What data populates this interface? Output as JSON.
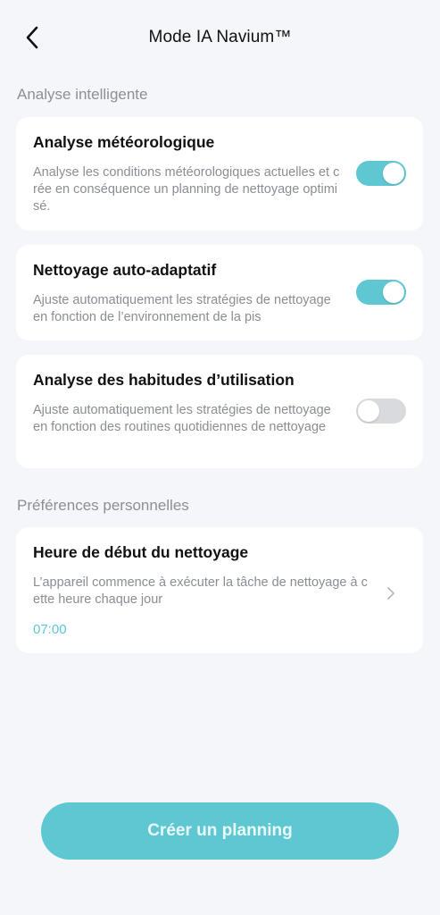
{
  "header": {
    "title": "Mode IA Navium™",
    "back_icon": "chevron-left-icon"
  },
  "sections": {
    "smart_analysis": "Analyse intelligente",
    "personal_preferences": "Préférences personnelles"
  },
  "cards": [
    {
      "title": "Analyse météorologique",
      "description": "Analyse les conditions météorologiques actuelles et crée en conséquence un planning de nettoyage optimisé.",
      "toggle": "on"
    },
    {
      "title": "Nettoyage auto-adaptatif",
      "description": "Ajuste automatiquement les stratégies de nettoyage en fonction de l’environnement de la pis",
      "toggle": "on"
    },
    {
      "title": "Analyse des habitudes d’utilisation",
      "description": "Ajuste automatiquement les stratégies de nettoyage en fonction des routines quotidiennes de nettoyage",
      "toggle": "off"
    }
  ],
  "start_time": {
    "title": "Heure de début du nettoyage",
    "description": "L’appareil commence à exécuter la tâche de nettoyage à cette heure chaque jour",
    "value": "07:00",
    "chevron_icon": "chevron-right-icon"
  },
  "cta": {
    "label": "Créer un planning"
  },
  "colors": {
    "accent": "#5ec7d1",
    "background": "#f5f6fa",
    "toggle_off": "#d9dadd",
    "secondary_text": "#8a8d94"
  }
}
